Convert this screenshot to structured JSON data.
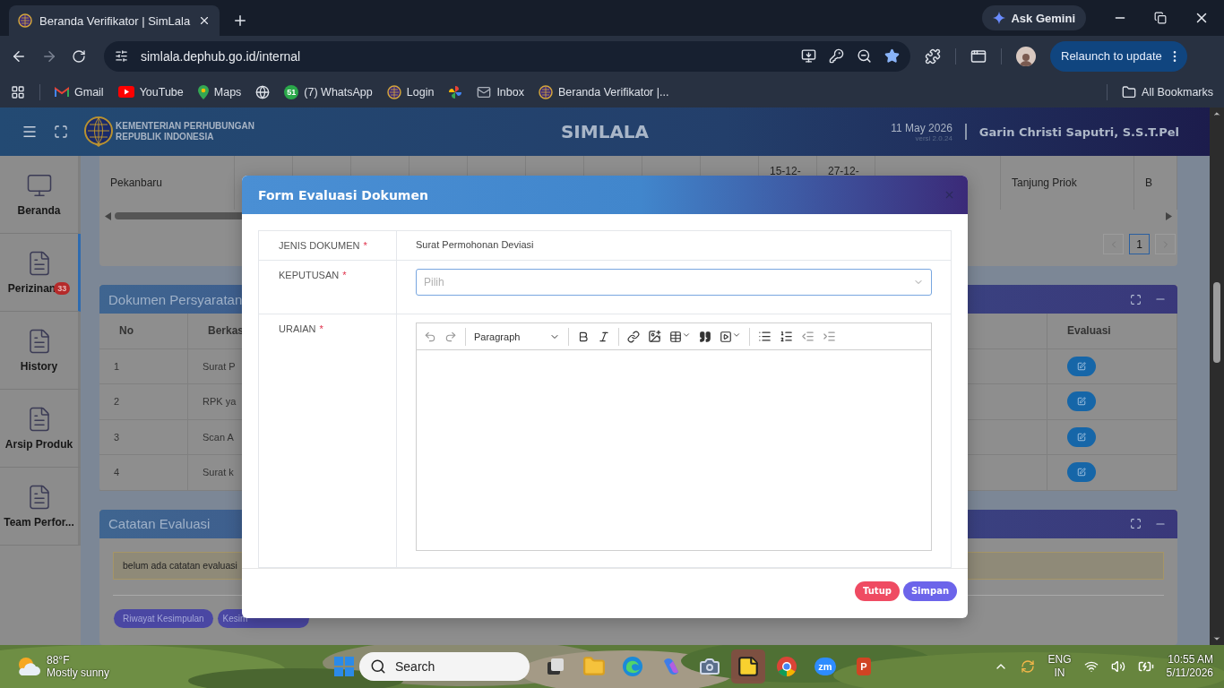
{
  "browser": {
    "tab": {
      "title": "Beranda Verifikator | SimLala"
    },
    "ask_button": "Ask Gemini",
    "url": "simlala.dephub.go.id/internal",
    "relaunch": "Relaunch to update",
    "bookmarks": [
      {
        "kind": "gmail",
        "label": "Gmail"
      },
      {
        "kind": "youtube",
        "label": "YouTube"
      },
      {
        "kind": "maps",
        "label": "Maps"
      },
      {
        "kind": "globe"
      },
      {
        "kind": "chat",
        "badge": "51",
        "label": "(7) WhatsApp"
      },
      {
        "kind": "emblem",
        "label": "Login"
      },
      {
        "kind": "pinwheel"
      },
      {
        "kind": "mail",
        "label": "Inbox"
      },
      {
        "kind": "emblem",
        "label": "Beranda Verifikator |..."
      }
    ],
    "all_bookmarks": "All Bookmarks"
  },
  "app_header": {
    "org_lines": [
      "KEMENTERIAN PERHUBUNGAN",
      "REPUBLIK INDONESIA"
    ],
    "title": "SIMLALA",
    "date": "11 May 2026",
    "version": "versi 2.0.24",
    "user": "Garin Christi Saputri, S.S.T.Pel"
  },
  "sidebar": {
    "items": [
      {
        "kind": "monitor",
        "label": "Beranda",
        "selected": false
      },
      {
        "kind": "document",
        "label": "Perizinan",
        "badge": "33",
        "selected": true
      },
      {
        "kind": "document",
        "label": "History",
        "selected": false
      },
      {
        "kind": "document",
        "label": "Arsip Produk",
        "selected": false
      },
      {
        "kind": "document",
        "label": "Team Perfor...",
        "selected": false
      }
    ]
  },
  "schedule_card": {
    "cells": [
      {
        "text": "Pekanbaru"
      },
      {},
      {},
      {},
      {},
      {},
      {},
      {},
      {},
      {},
      {
        "text": "15-12-",
        "kind": "date"
      },
      {
        "text": "27-12-",
        "kind": "date"
      },
      {},
      {
        "text": "Tanjung Priok"
      },
      {
        "text": "B"
      }
    ],
    "pages": [
      {
        "label": "1",
        "selected": true
      }
    ]
  },
  "documents_card": {
    "title": "Dokumen Persyaratan",
    "columns": [
      "No",
      "Berkas",
      "Evaluasi"
    ],
    "rows": [
      {
        "no": "1",
        "file": "Surat P"
      },
      {
        "no": "2",
        "file": "RPK ya"
      },
      {
        "no": "3",
        "file": "Scan A"
      },
      {
        "no": "4",
        "file": "Surat k"
      }
    ]
  },
  "notes_card": {
    "title": "Catatan Evaluasi",
    "note": "belum ada catatan evaluasi",
    "buttons": [
      "Riwayat Kesimpulan",
      "Kesim"
    ]
  },
  "modal": {
    "title": "Form Evaluasi Dokumen",
    "fields": [
      {
        "kind": "text",
        "label": "JENIS DOKUMEN",
        "required": "*",
        "value": "Surat Permohonan Deviasi"
      },
      {
        "kind": "select",
        "label": "KEPUTUSAN",
        "required": "*",
        "placeholder": "Pilih"
      },
      {
        "kind": "editor",
        "label": "URAIAN",
        "required": "*",
        "format": "Paragraph"
      }
    ],
    "buttons": [
      {
        "label": "Tutup",
        "kind": "danger"
      },
      {
        "label": "Simpan",
        "kind": "primary"
      }
    ]
  },
  "taskbar": {
    "weather": {
      "temp": "88°F",
      "condition": "Mostly sunny"
    },
    "search": {
      "placeholder": "Search"
    },
    "apps": [
      {
        "kind": "taskview",
        "selected": false
      },
      {
        "kind": "folder",
        "selected": false
      },
      {
        "kind": "edge",
        "selected": false
      },
      {
        "kind": "copilot",
        "selected": false
      },
      {
        "kind": "camera",
        "selected": false
      },
      {
        "kind": "notes",
        "selected": true
      },
      {
        "kind": "chrome",
        "selected": false
      },
      {
        "kind": "zoom",
        "text": "zm",
        "selected": false
      },
      {
        "kind": "slides",
        "text": "P",
        "selected": false
      }
    ],
    "tray": {
      "lang": "ENG",
      "region": "IN",
      "time": "10:55 AM",
      "date": "5/11/2026"
    }
  }
}
